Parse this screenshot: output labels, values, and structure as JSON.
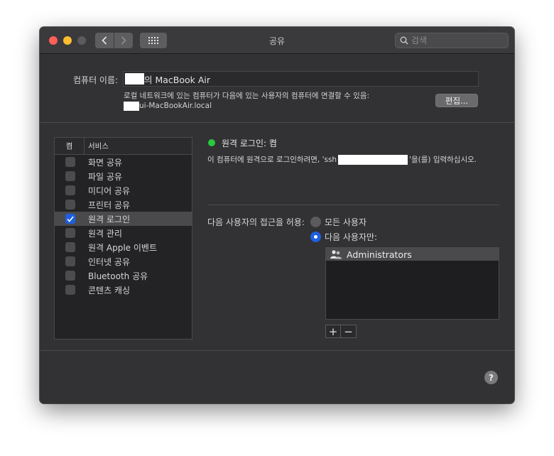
{
  "window": {
    "title": "공유",
    "search_placeholder": "검색"
  },
  "computer_name": {
    "label": "컴퓨터 이름:",
    "value": "의 MacBook Air",
    "note_line1": "로컬 네트워크에 있는 컴퓨터가 다음에 있는 사용자의 컴퓨터에 연결할 수 있음:",
    "note_line2": "ui-MacBookAir.local",
    "edit_label": "편집..."
  },
  "services": {
    "col_on": "켬",
    "col_service": "서비스",
    "items": [
      {
        "label": "화면 공유",
        "checked": false
      },
      {
        "label": "파일 공유",
        "checked": false
      },
      {
        "label": "미디어 공유",
        "checked": false
      },
      {
        "label": "프린터 공유",
        "checked": false
      },
      {
        "label": "원격 로그인",
        "checked": true
      },
      {
        "label": "원격 관리",
        "checked": false
      },
      {
        "label": "원격 Apple 이벤트",
        "checked": false
      },
      {
        "label": "인터넷 공유",
        "checked": false
      },
      {
        "label": "Bluetooth 공유",
        "checked": false
      },
      {
        "label": "콘텐츠 캐싱",
        "checked": false
      }
    ]
  },
  "detail": {
    "status": "원격 로그인: 켬",
    "instr_before": "이 컴퓨터에 원격으로 로그인하려면, 'ssh",
    "instr_after": "'을(를) 입력하십시오.",
    "access_label": "다음 사용자의 접근을 허용:",
    "radio_all": "모든 사용자",
    "radio_only": "다음 사용자만:",
    "users": [
      "Administrators"
    ],
    "add": "+",
    "remove": "−"
  },
  "help": "?",
  "colors": {
    "status_on": "#27c93f",
    "accent": "#1f5fe0"
  }
}
